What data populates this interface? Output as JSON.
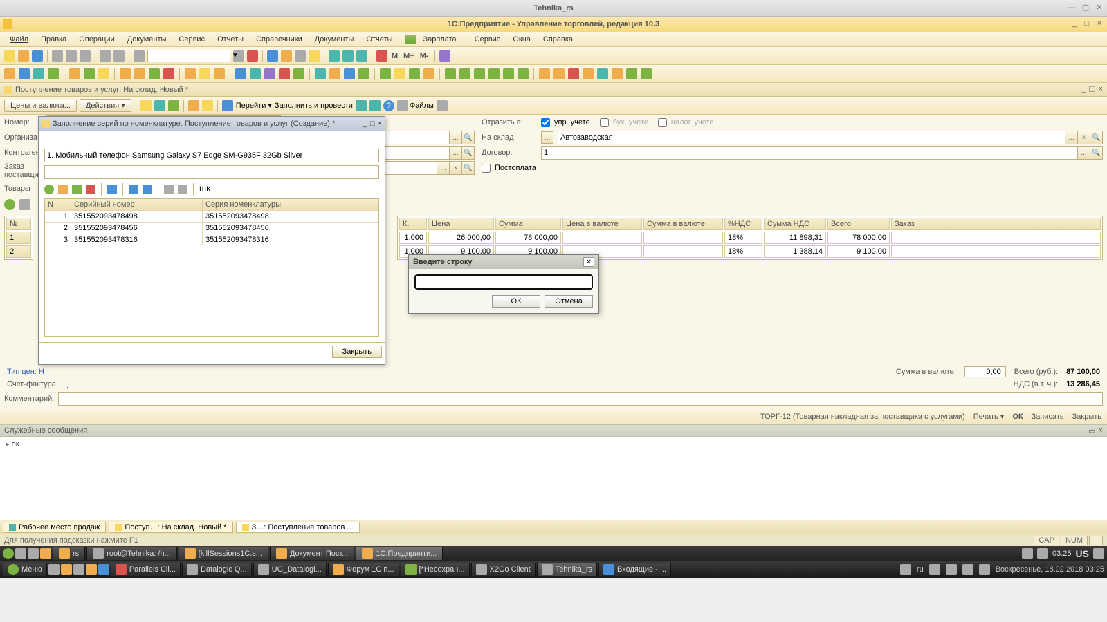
{
  "outer_window": {
    "title": "Tehnika_rs"
  },
  "inner_window": {
    "title": "1С:Предприятие - Управление торговлей, редакция 10.3"
  },
  "mainmenu": [
    "Файл",
    "Правка",
    "Операции",
    "Документы",
    "Сервис",
    "Отчеты",
    "Справочники",
    "Документы",
    "Отчеты"
  ],
  "mainmenu_salary": "Зарплата",
  "mainmenu_tail": [
    "Сервис",
    "Окна",
    "Справка"
  ],
  "mem_buttons": [
    "M",
    "M+",
    "M-"
  ],
  "doc_tab": "Поступление товаров и услуг: На склад. Новый *",
  "doc_toolbar": {
    "prices": "Цены и валюта...",
    "actions": "Действия",
    "go": "Перейти",
    "fill_post": "Заполнить и провести",
    "files": "Файлы"
  },
  "form_left_labels": {
    "number": "Номер:",
    "org": "Организа",
    "contr": "Контраген",
    "order": "Заказ\nпоставщи",
    "goods": "Товары"
  },
  "form_right": {
    "reflect_label": "Отразить в:",
    "upr": "упр. учете",
    "buh": "бух. учете",
    "nalog": "налог. учете",
    "warehouse_label": "На склад",
    "warehouse_value": "Автозаводская",
    "dogovor_label": "Договор:",
    "dogovor_value": "1",
    "postoplata": "Постоплата"
  },
  "numcol": [
    "№",
    "1",
    "2"
  ],
  "main_table": {
    "headers": [
      "К.",
      "Цена",
      "Сумма",
      "Цена в валюте",
      "Сумма в валюте",
      "%НДС",
      "Сумма НДС",
      "Всего",
      "Заказ"
    ],
    "rows": [
      {
        "k": "1,000",
        "price": "26 000,00",
        "sum": "78 000,00",
        "pcur": "",
        "scur": "",
        "nds": "18%",
        "ndssum": "11 898,31",
        "total": "78 000,00",
        "ord": ""
      },
      {
        "k": "1,000",
        "price": "9 100,00",
        "sum": "9 100,00",
        "pcur": "",
        "scur": "",
        "nds": "18%",
        "ndssum": "1 388,14",
        "total": "9 100,00",
        "ord": ""
      }
    ]
  },
  "tip_cen": "Тип цен: Н",
  "totals": {
    "sumcur_label": "Сумма в валюте:",
    "sumcur": "0,00",
    "total_label": "Всего (руб.):",
    "total": "87 100,00",
    "nds_label": "НДС (в т. ч.):",
    "nds": "13 286,45"
  },
  "schet": "Счет-фактура:",
  "comment": "Комментарий:",
  "footer": {
    "torg": "ТОРГ-12 (Товарная накладная за поставщика с услугами)",
    "print": "Печать",
    "ok": "ОК",
    "save": "Записать",
    "close": "Закрыть"
  },
  "sys_header": "Служебные сообщения",
  "sys_body": "ок",
  "bottom_tabs": [
    {
      "label": "Рабочее место продаж",
      "active": false
    },
    {
      "label": "Поступ…: На склад. Новый *",
      "active": false
    },
    {
      "label": "З…: Поступление товаров ...",
      "active": true
    }
  ],
  "status_hint": "Для получения подсказки нажмите F1",
  "status_cells": [
    "CAP",
    "NUM"
  ],
  "vm_taskbar": {
    "items": [
      "rs",
      "root@Tehnika: /h...",
      "[killSessions1C.s...",
      "Документ Пост...",
      "1С:Предприяти..."
    ],
    "clock": "03:25",
    "kbd": "US"
  },
  "mint_taskbar": {
    "menu": "Меню",
    "items": [
      "Parallels Cli...",
      "Datalogic Q...",
      "UG_Datalogi...",
      "Форум 1С п...",
      "[*Несохран...",
      "X2Go Client",
      "Tehnika_rs",
      "Входящие - ..."
    ],
    "lang": "ru",
    "date": "Воскресенье, 18.02.2018 03:25"
  },
  "serials_modal": {
    "title": "Заполнение серий по номенклатуре: Поступление товаров и услуг (Создание) *",
    "item": "1. Мобильный телефон Samsung Galaxy S7 Edge SM-G935F 32Gb Silver",
    "cols": {
      "n": "N",
      "ser": "Серийный номер",
      "serija": "Серия номенклатуры"
    },
    "shk": "ШК",
    "rows": [
      {
        "n": "1",
        "ser": "351552093478498",
        "serija": "351552093478498"
      },
      {
        "n": "2",
        "ser": "351552093478456",
        "serija": "351552093478456"
      },
      {
        "n": "3",
        "ser": "351552093478316",
        "serija": "351552093478316"
      }
    ],
    "close": "Закрыть"
  },
  "input_dlg": {
    "title": "Введите строку",
    "ok": "ОК",
    "cancel": "Отмена"
  }
}
